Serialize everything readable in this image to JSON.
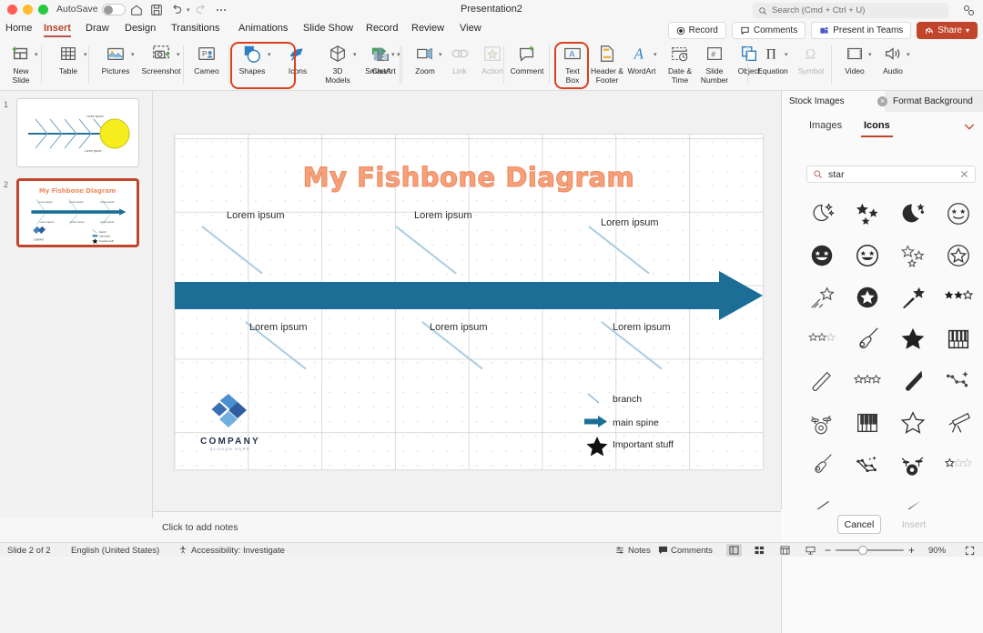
{
  "titlebar": {
    "autosave_label": "AutoSave",
    "doc_title": "Presentation2",
    "search_placeholder": "Search (Cmd + Ctrl + U)",
    "icons": [
      "home-icon",
      "save-icon",
      "undo-icon",
      "redo-icon",
      "more-icon"
    ]
  },
  "menu": {
    "tabs": [
      {
        "label": "Home",
        "active": false
      },
      {
        "label": "Insert",
        "active": true
      },
      {
        "label": "Draw",
        "active": false
      },
      {
        "label": "Design",
        "active": false
      },
      {
        "label": "Transitions",
        "active": false
      },
      {
        "label": "Animations",
        "active": false
      },
      {
        "label": "Slide Show",
        "active": false
      },
      {
        "label": "Record",
        "active": false
      },
      {
        "label": "Review",
        "active": false
      },
      {
        "label": "View",
        "active": false
      }
    ],
    "right_buttons": [
      {
        "label": "Record",
        "icon": "record-icon"
      },
      {
        "label": "Comments",
        "icon": "comment-icon"
      },
      {
        "label": "Present in Teams",
        "icon": "teams-icon"
      },
      {
        "label": "Share",
        "icon": "share-icon"
      }
    ]
  },
  "ribbon": {
    "items": [
      {
        "label": "New\nSlide",
        "icon": "new-slide-icon",
        "dropdown": true,
        "dim": false
      },
      {
        "label": "Table",
        "icon": "table-icon",
        "dropdown": true,
        "dim": false
      },
      {
        "label": "Pictures",
        "icon": "pictures-icon",
        "dropdown": true,
        "dim": false
      },
      {
        "label": "Screenshot",
        "icon": "screenshot-icon",
        "dropdown": true,
        "dim": false
      },
      {
        "label": "Cameo",
        "icon": "cameo-icon",
        "dropdown": false,
        "dim": false
      },
      {
        "label": "Shapes",
        "icon": "shapes-icon",
        "dropdown": true,
        "dim": false
      },
      {
        "label": "Icons",
        "icon": "icons-icon",
        "dropdown": false,
        "dim": false
      },
      {
        "label": "3D\nModels",
        "icon": "3d-models-icon",
        "dropdown": true,
        "dim": false
      },
      {
        "label": "SmartArt",
        "icon": "smartart-icon",
        "dropdown": true,
        "dim": false
      },
      {
        "label": "Chart",
        "icon": "chart-icon",
        "dropdown": true,
        "dim": false
      },
      {
        "label": "Zoom",
        "icon": "zoom-icon",
        "dropdown": true,
        "dim": false
      },
      {
        "label": "Link",
        "icon": "link-icon",
        "dropdown": false,
        "dim": true
      },
      {
        "label": "Action",
        "icon": "action-icon",
        "dropdown": false,
        "dim": true
      },
      {
        "label": "Comment",
        "icon": "comment-icon",
        "dropdown": false,
        "dim": false
      },
      {
        "label": "Text\nBox",
        "icon": "text-box-icon",
        "dropdown": false,
        "dim": false
      },
      {
        "label": "Header &\nFooter",
        "icon": "header-footer-icon",
        "dropdown": false,
        "dim": false
      },
      {
        "label": "WordArt",
        "icon": "wordart-icon",
        "dropdown": true,
        "dim": false
      },
      {
        "label": "Date &\nTime",
        "icon": "date-time-icon",
        "dropdown": false,
        "dim": false
      },
      {
        "label": "Slide\nNumber",
        "icon": "slide-number-icon",
        "dropdown": false,
        "dim": false
      },
      {
        "label": "Object",
        "icon": "object-icon",
        "dropdown": false,
        "dim": false
      },
      {
        "label": "Equation",
        "icon": "equation-icon",
        "dropdown": true,
        "dim": false
      },
      {
        "label": "Symbol",
        "icon": "symbol-icon",
        "dropdown": false,
        "dim": true
      },
      {
        "label": "Video",
        "icon": "video-icon",
        "dropdown": true,
        "dim": false
      },
      {
        "label": "Audio",
        "icon": "audio-icon",
        "dropdown": true,
        "dim": false
      }
    ],
    "highlight_color": "#d9411e"
  },
  "thumbnails": [
    {
      "number": "1",
      "selected": false
    },
    {
      "number": "2",
      "selected": true
    }
  ],
  "slide": {
    "title": "My Fishbone Diagram",
    "title_color": "#f7a07a",
    "spine_color": "#1c6e96",
    "branch_color": "#a9cde0",
    "top_labels": [
      "Lorem ipsum",
      "Lorem ipsum",
      "Lorem ipsum"
    ],
    "bottom_labels": [
      "Lorem ipsum",
      "Lorem ipsum",
      "Lorem ipsum"
    ],
    "legend": [
      {
        "label": "branch",
        "icon": "diagonal-line-icon"
      },
      {
        "label": "main spine",
        "icon": "arrow-right-icon"
      },
      {
        "label": "Important stuff",
        "icon": "star-icon"
      }
    ],
    "logo": {
      "name": "COMPANY",
      "slogan": "SLOGAN HERE"
    }
  },
  "notes": {
    "placeholder": "Click to add notes"
  },
  "pane": {
    "tabs": [
      {
        "label": "Stock Images",
        "active": true,
        "closable": true
      },
      {
        "label": "Format Background",
        "active": false,
        "closable": false
      }
    ],
    "subtabs": [
      {
        "label": "Images",
        "active": false
      },
      {
        "label": "Icons",
        "active": true
      }
    ],
    "collapse_icon": "chevron-down-icon",
    "search": {
      "value": "star",
      "icon": "search-icon",
      "clear_icon": "clear-icon"
    },
    "icon_results": [
      "moon-stars-outline-icon",
      "three-stars-filled-icon",
      "moon-star-filled-icon",
      "star-eyes-face-outline-icon",
      "star-eyes-face-filled-icon",
      "star-eyes-face-dark-icon",
      "three-stars-outline-icon",
      "star-in-circle-outline-icon",
      "shooting-star-outline-icon",
      "star-in-circle-filled-icon",
      "shooting-star-filled-icon",
      "two-and-half-stars-icon",
      "rating-two-stars-outline-icon",
      "electric-guitar-icon",
      "star-filled-icon",
      "piano-keys-filled-icon",
      "drumstick-outline-icon",
      "three-stars-rating-icon",
      "drumstick-filled-icon",
      "constellation-outline-icon",
      "drum-kit-outline-icon",
      "piano-keys-outline-icon",
      "star-outline-icon",
      "telescope-icon",
      "guitar-outline-icon",
      "constellation-filled-icon",
      "drum-kit-filled-icon",
      "one-star-rating-icon",
      "feather-outline-icon",
      "feather-filled-icon"
    ],
    "buttons": [
      {
        "label": "Cancel",
        "disabled": false
      },
      {
        "label": "Insert",
        "disabled": true
      }
    ]
  },
  "status": {
    "slide_count": "Slide 2 of 2",
    "language": "English (United States)",
    "accessibility": "Accessibility: Investigate",
    "notes_label": "Notes",
    "comments_label": "Comments",
    "zoom_level": "90%",
    "views": [
      "normal-view-icon",
      "slide-sorter-icon",
      "reading-view-icon",
      "slideshow-icon"
    ]
  }
}
